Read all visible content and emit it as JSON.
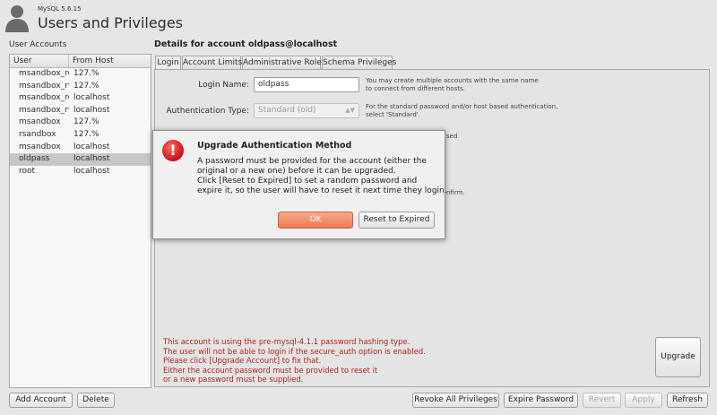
{
  "header": {
    "version": "MySQL 5.6.15",
    "title": "Users and Privileges"
  },
  "accounts": {
    "label": "User Accounts",
    "columns": {
      "user": "User",
      "host": "From Host"
    },
    "rows": [
      {
        "user": "msandbox_ro",
        "host": "127.%"
      },
      {
        "user": "msandbox_rw",
        "host": "127.%"
      },
      {
        "user": "msandbox_ro",
        "host": "localhost"
      },
      {
        "user": "msandbox_rw",
        "host": "localhost"
      },
      {
        "user": "msandbox",
        "host": "127.%"
      },
      {
        "user": "rsandbox",
        "host": "127.%"
      },
      {
        "user": "msandbox",
        "host": "localhost"
      },
      {
        "user": "oldpass",
        "host": "localhost"
      },
      {
        "user": "root",
        "host": "localhost"
      }
    ],
    "selected_index": 7,
    "add_label": "Add Account",
    "delete_label": "Delete"
  },
  "details": {
    "title": "Details for account oldpass@localhost",
    "tabs": [
      "Login",
      "Account Limits",
      "Administrative Roles",
      "Schema Privileges"
    ],
    "login_name_label": "Login Name:",
    "login_name_value": "oldpass",
    "login_help": [
      "You may create multiple accounts with the same name",
      "to connect from different hosts."
    ],
    "auth_type_label": "Authentication Type:",
    "auth_type_value": "Standard (old)",
    "auth_help": [
      "For the standard password and/or host based authentication,",
      "select 'Standard'."
    ],
    "partial_sed": "sed",
    "partial_confirm": "nfirm.",
    "warning_lines": [
      "This account is using the pre-mysql-4.1.1 password hashing type.",
      "The user will not be able to login if the secure_auth option is enabled.",
      "Please click [Upgrade Account] to fix that.",
      "Either the account password must be provided to reset it",
      "or a new password must be supplied."
    ],
    "upgrade_label": "Upgrade"
  },
  "footer": {
    "revoke_label": "Revoke All Privileges",
    "expire_label": "Expire Password",
    "revert_label": "Revert",
    "apply_label": "Apply",
    "refresh_label": "Refresh"
  },
  "dialog": {
    "title": "Upgrade Authentication Method",
    "icon": "error-icon",
    "icon_glyph": "!",
    "message_lines": [
      "A password must be provided for the account (either the",
      "original or a new one) before it can be upgraded.",
      "Click [Reset to Expired] to set a random password and",
      "expire it, so the user will have to reset it next time they login."
    ],
    "ok_label": "OK",
    "reset_label": "Reset to Expired"
  },
  "colors": {
    "warning": "#b02424",
    "accent_button": "#ee7a55",
    "error_icon": "#c8101e"
  }
}
